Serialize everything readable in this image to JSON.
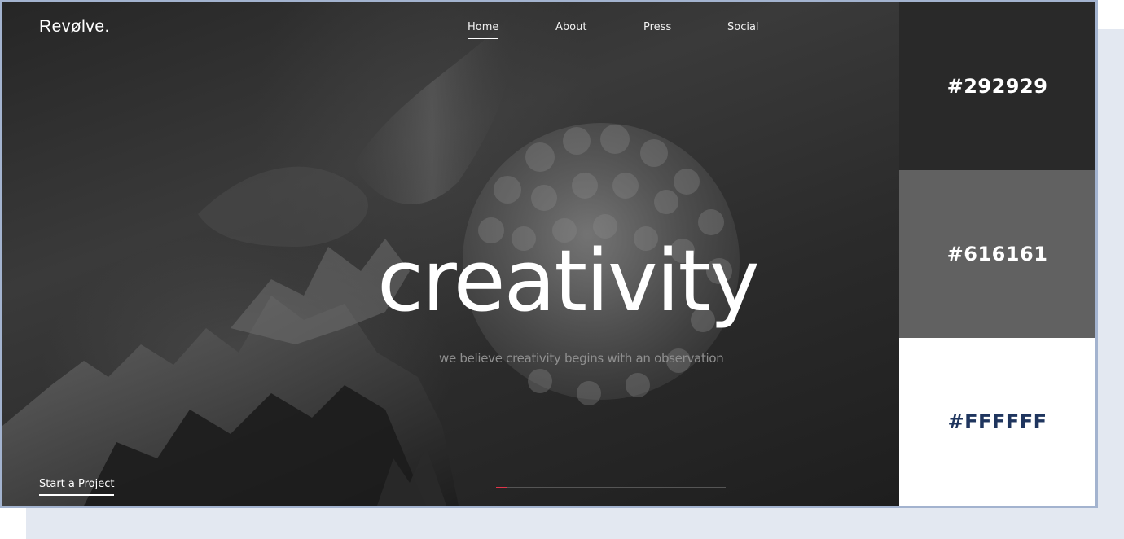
{
  "brand": {
    "logo_text": "Revølve."
  },
  "nav": {
    "items": [
      {
        "label": "Home",
        "active": true
      },
      {
        "label": "About",
        "active": false
      },
      {
        "label": "Press",
        "active": false
      },
      {
        "label": "Social",
        "active": false
      }
    ]
  },
  "hero": {
    "title": "creativity",
    "subtitle": "we believe creativity begins with an observation",
    "cta_label": "Start a Project",
    "slide_progress": 0.05,
    "progress_color": "#e0354a"
  },
  "palette": {
    "swatches": [
      {
        "label": "#292929",
        "color": "#292929",
        "text_color": "#ffffff"
      },
      {
        "label": "#616161",
        "color": "#616161",
        "text_color": "#ffffff"
      },
      {
        "label": "#FFFFFF",
        "color": "#ffffff",
        "text_color": "#1f355e"
      }
    ]
  }
}
